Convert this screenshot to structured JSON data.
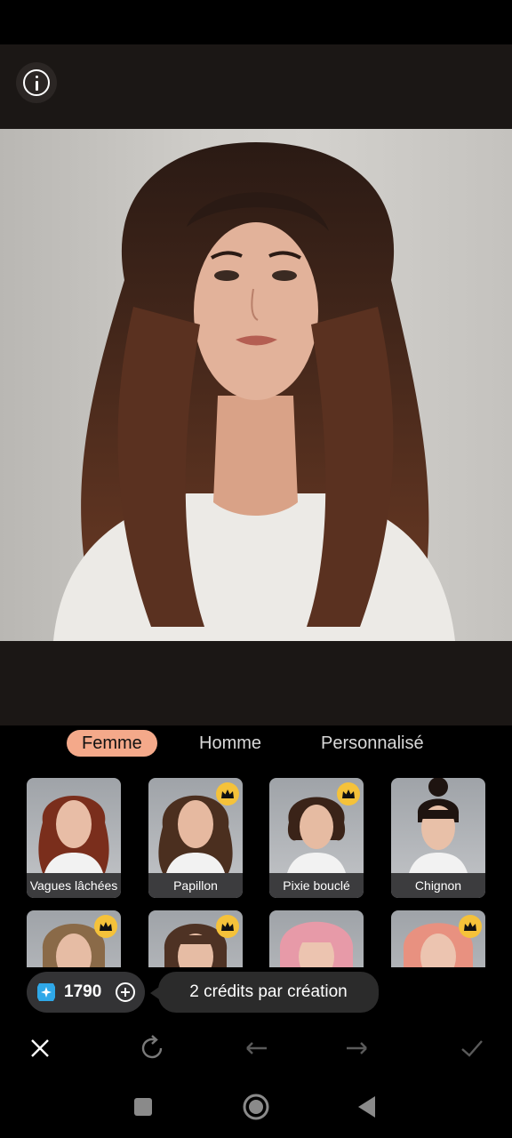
{
  "header": {
    "info_icon": "info-icon"
  },
  "photo": {
    "subject": "woman-portrait"
  },
  "tabs": [
    {
      "label": "Femme",
      "active": true
    },
    {
      "label": "Homme",
      "active": false
    },
    {
      "label": "Personnalisé",
      "active": false
    }
  ],
  "styles": [
    {
      "label": "Vagues lâchées",
      "premium": false
    },
    {
      "label": "Papillon",
      "premium": true
    },
    {
      "label": "Pixie bouclé",
      "premium": true
    },
    {
      "label": "Chignon",
      "premium": false
    },
    {
      "label": "",
      "premium": true
    },
    {
      "label": "",
      "premium": true
    },
    {
      "label": "",
      "premium": false
    },
    {
      "label": "",
      "premium": true
    }
  ],
  "credits": {
    "count": "1790",
    "tooltip": "2 crédits par création"
  },
  "toolbar": {
    "icons": [
      "close-icon",
      "refresh-icon",
      "undo-icon",
      "redo-icon",
      "check-icon"
    ]
  },
  "navbar": {
    "icons": [
      "recents-icon",
      "home-icon",
      "back-icon"
    ]
  },
  "colors": {
    "accent": "#f4a98a",
    "crown": "#f5c23a",
    "gem": "#2fa8e8"
  }
}
